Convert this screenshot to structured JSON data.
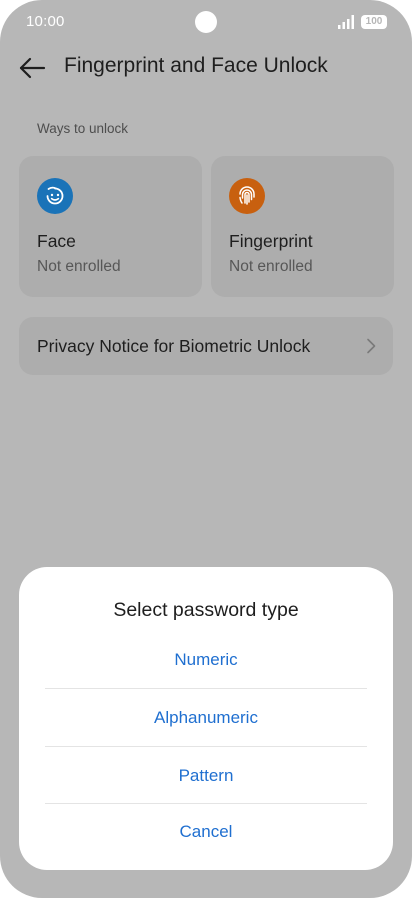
{
  "status_bar": {
    "time": "10:00",
    "battery": "100",
    "icons": [
      "camera-cutout",
      "signal-icon",
      "battery-icon"
    ]
  },
  "header": {
    "back_icon": "arrow-left-icon",
    "title": "Fingerprint and Face Unlock"
  },
  "section": {
    "label": "Ways to unlock"
  },
  "cards": [
    {
      "icon": "face-icon",
      "icon_color": "#1a73b8",
      "title": "Face",
      "status": "Not enrolled"
    },
    {
      "icon": "fingerprint-icon",
      "icon_color": "#c8600f",
      "title": "Fingerprint",
      "status": "Not enrolled"
    }
  ],
  "privacy_row": {
    "label": "Privacy Notice for Biometric Unlock",
    "icon": "chevron-right-icon"
  },
  "dialog": {
    "title": "Select password type",
    "options": [
      "Numeric",
      "Alphanumeric",
      "Pattern"
    ],
    "cancel": "Cancel",
    "accent_color": "#1f6fd0"
  },
  "colors": {
    "scrim_background": "#b7b7b7",
    "card_background": "#adadad",
    "sheet_background": "#ffffff"
  }
}
